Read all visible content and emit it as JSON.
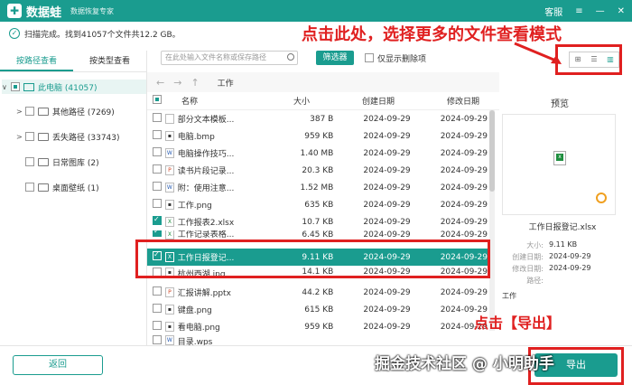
{
  "titlebar": {
    "logo_glyph": "✚",
    "app_name": "数据蛙",
    "app_sub": "数据恢复专家",
    "service": "客服",
    "menu_icon": "≡",
    "min_icon": "—",
    "close_icon": "✕"
  },
  "status": {
    "check_glyph": "✓",
    "text": "扫描完成。找到41057个文件共12.2 GB。"
  },
  "annotations": {
    "top": "点击此处，选择更多的文件查看模式",
    "export": "点击【导出】"
  },
  "sidebar": {
    "tabs": [
      "按路径查看",
      "按类型查看"
    ],
    "tree": [
      {
        "label": "此电脑 (41057)",
        "arrow": "∨"
      },
      {
        "label": "其他路径 (7269)",
        "arrow": ">"
      },
      {
        "label": "丢失路径 (33743)",
        "arrow": ">"
      },
      {
        "label": "日常图库 (2)",
        "arrow": ""
      },
      {
        "label": "桌面壁纸 (1)",
        "arrow": ""
      }
    ]
  },
  "toolbar": {
    "search_placeholder": "在此处输入文件名称或保存路径",
    "filter": "筛选器",
    "only_deleted": "仅显示删除项",
    "view_icons": [
      "⊞",
      "☰",
      "▥"
    ]
  },
  "nav": {
    "back": "←",
    "forward": "→",
    "up": "↑",
    "crumb": "工作"
  },
  "table": {
    "headers": {
      "name": "名称",
      "size": "大小",
      "created": "创建日期",
      "modified": "修改日期"
    },
    "rows": [
      {
        "icon": "",
        "name": "部分文本模板...",
        "size": "387 B",
        "created": "2024-09-29",
        "modified": "2024-09-29"
      },
      {
        "icon": "▪",
        "name": "电脑.bmp",
        "size": "959 KB",
        "created": "2024-09-29",
        "modified": "2024-09-29"
      },
      {
        "icon": "W",
        "name": "电脑操作技巧...",
        "size": "1.40 MB",
        "created": "2024-09-29",
        "modified": "2024-09-29"
      },
      {
        "icon": "P",
        "name": "读书片段记录...",
        "size": "20.3 KB",
        "created": "2024-09-29",
        "modified": "2024-09-29"
      },
      {
        "icon": "W",
        "name": "附：使用注意...",
        "size": "1.52 MB",
        "created": "2024-09-29",
        "modified": "2024-09-29"
      },
      {
        "icon": "▪",
        "name": "工作.png",
        "size": "635 KB",
        "created": "2024-09-29",
        "modified": "2024-09-29"
      },
      {
        "icon": "X",
        "name": "工作报表2.xlsx",
        "size": "10.7 KB",
        "created": "2024-09-29",
        "modified": "2024-09-29"
      },
      {
        "icon": "X",
        "name": "工作记录表格...",
        "size": "6.45 KB",
        "created": "2024-09-29",
        "modified": "2024-09-29"
      },
      {
        "icon": "X",
        "name": "工作日报登记...",
        "size": "9.11 KB",
        "created": "2024-09-29",
        "modified": "2024-09-29"
      },
      {
        "icon": "▪",
        "name": "杭州西湖.jpg",
        "size": "14.1 KB",
        "created": "2024-09-29",
        "modified": "2024-09-29"
      },
      {
        "icon": "P",
        "name": "汇报讲解.pptx",
        "size": "44.2 KB",
        "created": "2024-09-29",
        "modified": "2024-09-29"
      },
      {
        "icon": "▪",
        "name": "键盘.png",
        "size": "615 KB",
        "created": "2024-09-29",
        "modified": "2024-09-29"
      },
      {
        "icon": "▪",
        "name": "看电脑.png",
        "size": "959 KB",
        "created": "2024-09-29",
        "modified": "2024-09-29"
      },
      {
        "icon": "W",
        "name": "目录.wps",
        "size": "",
        "created": "",
        "modified": ""
      }
    ]
  },
  "preview": {
    "title": "预览",
    "filename": "工作日报登记.xlsx",
    "meta": [
      {
        "k": "大小:",
        "v": "9.11 KB"
      },
      {
        "k": "创建日期:",
        "v": "2024-09-29"
      },
      {
        "k": "修改日期:",
        "v": "2024-09-29"
      },
      {
        "k": "路径:",
        "v": ""
      }
    ],
    "path_value": "工作"
  },
  "bottom": {
    "back": "返回",
    "export": "导出"
  },
  "watermark": "掘金技术社区 @ 小明助手"
}
